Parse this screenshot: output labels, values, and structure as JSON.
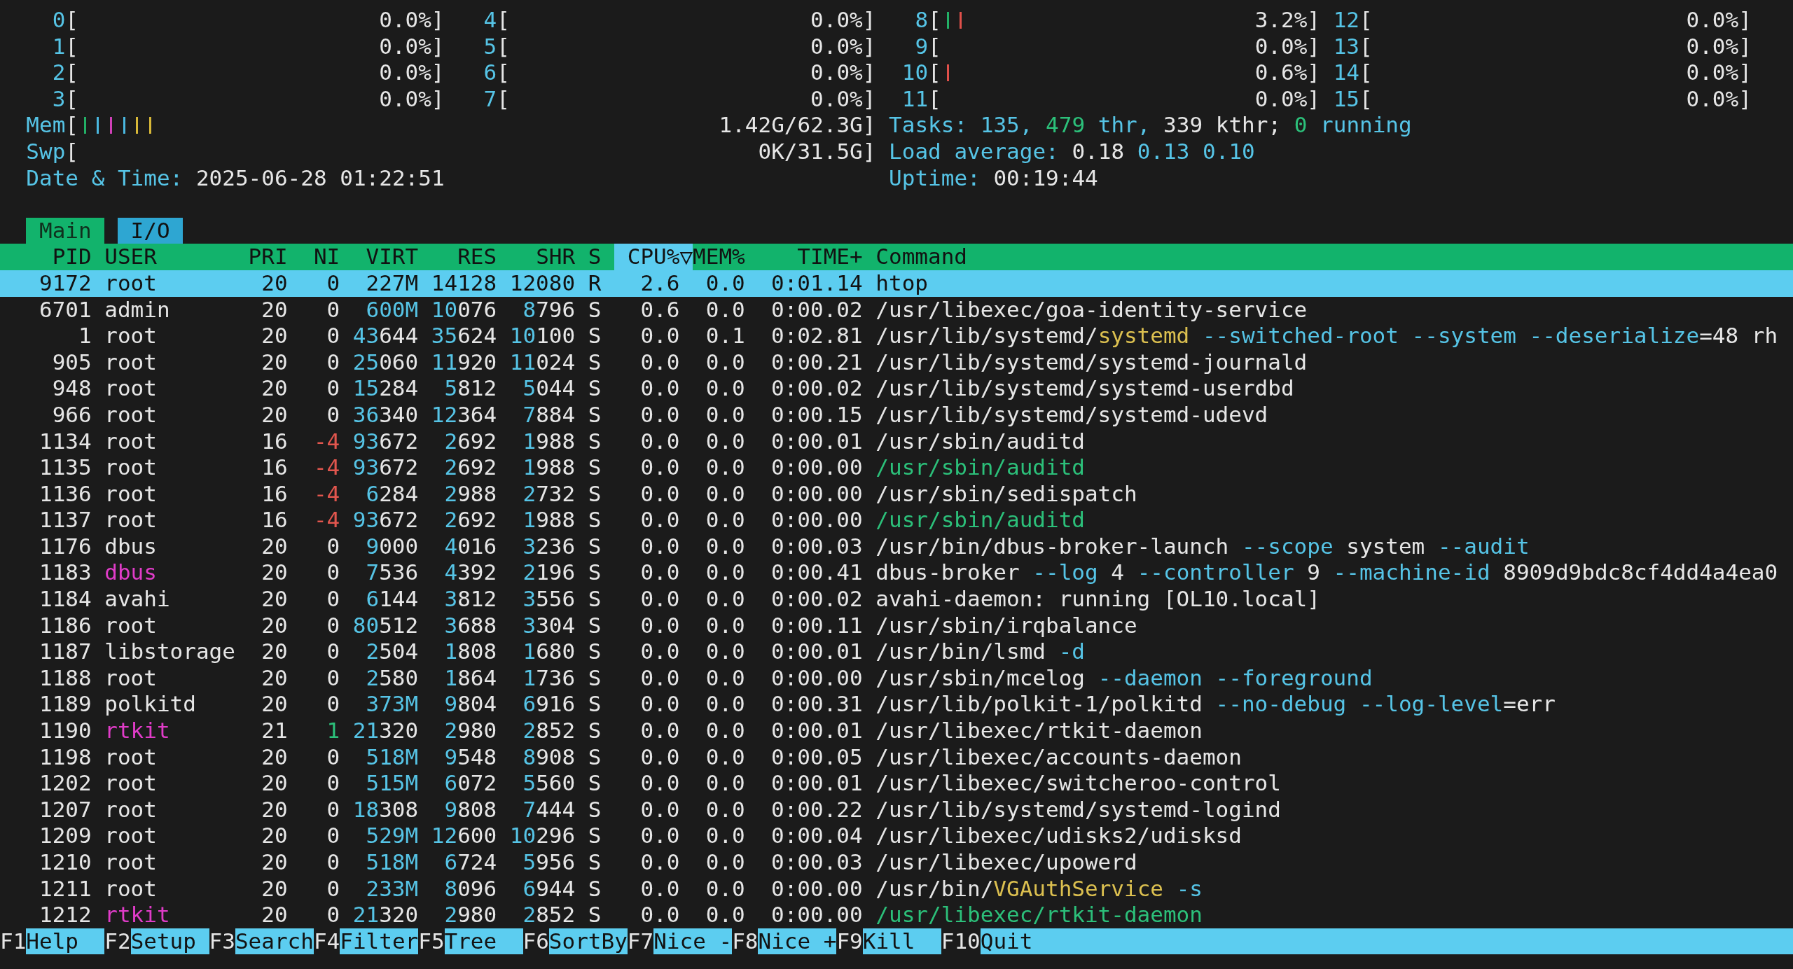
{
  "cpu_meters": [
    {
      "label": "0",
      "open": "[",
      "reading": "0.0%]"
    },
    {
      "label": "1",
      "open": "[",
      "reading": "0.0%]"
    },
    {
      "label": "2",
      "open": "[",
      "reading": "0.0%]"
    },
    {
      "label": "3",
      "open": "[",
      "reading": "0.0%]"
    },
    {
      "label": "4",
      "open": "[",
      "reading": "0.0%]"
    },
    {
      "label": "5",
      "open": "[",
      "reading": "0.0%]"
    },
    {
      "label": "6",
      "open": "[",
      "reading": "0.0%]"
    },
    {
      "label": "7",
      "open": "[",
      "reading": "0.0%]"
    },
    {
      "label": "8",
      "open": "[",
      "reading": "3.2%]",
      "ticks": [
        {
          "color": "#22b066"
        },
        {
          "color": "#e0504a"
        }
      ]
    },
    {
      "label": "9",
      "open": "[",
      "reading": "0.0%]"
    },
    {
      "label": "10",
      "open": "[",
      "reading": "0.6%]",
      "ticks": [
        {
          "color": "#e0504a"
        }
      ]
    },
    {
      "label": "11",
      "open": "[",
      "reading": "0.0%]"
    },
    {
      "label": "12",
      "open": "[",
      "reading": "0.0%]"
    },
    {
      "label": "13",
      "open": "[",
      "reading": "0.0%]"
    },
    {
      "label": "14",
      "open": "[",
      "reading": "0.0%]"
    },
    {
      "label": "15",
      "open": "[",
      "reading": "0.0%]"
    }
  ],
  "memory": {
    "label": "Mem",
    "open": "[",
    "reading": "1.42G/62.3G]",
    "ticks": [
      {
        "color": "#22b066"
      },
      {
        "color": "#4ab8e0"
      },
      {
        "color": "#d040b8"
      },
      {
        "color": "#4ab8e0"
      },
      {
        "color": "#d8b838"
      },
      {
        "color": "#d8b838"
      }
    ]
  },
  "swap": {
    "label": "Swp",
    "open": "[",
    "reading": "0K/31.5G]"
  },
  "tasks": [
    {
      "text": "Tasks: ",
      "kind": "label"
    },
    {
      "text": "135",
      "kind": "label"
    },
    {
      "text": ", ",
      "kind": "label"
    },
    {
      "text": "479",
      "kind": "green"
    },
    {
      "text": " thr, ",
      "kind": "label"
    },
    {
      "text": "339 kthr; ",
      "kind": "value"
    },
    {
      "text": "0",
      "kind": "green"
    },
    {
      "text": " running",
      "kind": "label"
    }
  ],
  "load_average": [
    {
      "text": "Load average: ",
      "kind": "label"
    },
    {
      "text": "0.18 ",
      "kind": "value"
    },
    {
      "text": "0.13 0.10",
      "kind": "label"
    }
  ],
  "date_time": [
    {
      "text": "Date & Time: ",
      "kind": "label"
    },
    {
      "text": "2025-06-28 01:22:51",
      "kind": "value"
    }
  ],
  "uptime": [
    {
      "text": "Uptime: ",
      "kind": "label"
    },
    {
      "text": "00:19:44",
      "kind": "value"
    }
  ],
  "tabs": [
    {
      "label": "Main",
      "selected": true
    },
    {
      "label": "I/O",
      "selected": false
    }
  ],
  "columns": [
    {
      "label": "PID",
      "selected": false
    },
    {
      "label": "USER",
      "selected": false
    },
    {
      "label": "PRI",
      "selected": false
    },
    {
      "label": "NI",
      "selected": false
    },
    {
      "label": "VIRT",
      "selected": false
    },
    {
      "label": "RES",
      "selected": false
    },
    {
      "label": "SHR",
      "selected": false
    },
    {
      "label": "S",
      "selected": false
    },
    {
      "label": "CPU%▽",
      "selected": true
    },
    {
      "label": "MEM%",
      "selected": false
    },
    {
      "label": "TIME+",
      "selected": false
    },
    {
      "label": "Command",
      "selected": false
    }
  ],
  "processes": [
    {
      "pid": "9172",
      "user": "root",
      "highlighted_user": false,
      "pri": "20",
      "ni": "0",
      "nice_negative": false,
      "nice_positive": false,
      "virt": "227M",
      "res": "14128",
      "shr": "12080",
      "state": "R",
      "cpu": "2.6",
      "mem": "0.0",
      "time": "0:01.14",
      "command": [
        {
          "text": "htop",
          "kind": "path"
        }
      ],
      "selected": true
    },
    {
      "pid": "6701",
      "user": "admin",
      "highlighted_user": false,
      "pri": "20",
      "ni": "0",
      "nice_negative": false,
      "nice_positive": false,
      "virt": "600M",
      "res": "10076",
      "shr": "8796",
      "state": "S",
      "cpu": "0.6",
      "mem": "0.0",
      "time": "0:00.02",
      "command": [
        {
          "text": "/usr/libexec/goa-identity-service",
          "kind": "path"
        }
      ],
      "selected": false
    },
    {
      "pid": "1",
      "user": "root",
      "highlighted_user": false,
      "pri": "20",
      "ni": "0",
      "nice_negative": false,
      "nice_positive": false,
      "virt": "43644",
      "res": "35624",
      "shr": "10100",
      "state": "S",
      "cpu": "0.0",
      "mem": "0.1",
      "time": "0:02.81",
      "command": [
        {
          "text": "/usr/lib/systemd/",
          "kind": "path"
        },
        {
          "text": "systemd",
          "kind": "basename"
        },
        {
          "text": " --switched-root --system --deserialize",
          "kind": "arg"
        },
        {
          "text": "=48 rh",
          "kind": "path"
        }
      ],
      "selected": false
    },
    {
      "pid": "905",
      "user": "root",
      "highlighted_user": false,
      "pri": "20",
      "ni": "0",
      "nice_negative": false,
      "nice_positive": false,
      "virt": "25060",
      "res": "11920",
      "shr": "11024",
      "state": "S",
      "cpu": "0.0",
      "mem": "0.0",
      "time": "0:00.21",
      "command": [
        {
          "text": "/usr/lib/systemd/systemd-journald",
          "kind": "path"
        }
      ],
      "selected": false
    },
    {
      "pid": "948",
      "user": "root",
      "highlighted_user": false,
      "pri": "20",
      "ni": "0",
      "nice_negative": false,
      "nice_positive": false,
      "virt": "15284",
      "res": "5812",
      "shr": "5044",
      "state": "S",
      "cpu": "0.0",
      "mem": "0.0",
      "time": "0:00.02",
      "command": [
        {
          "text": "/usr/lib/systemd/systemd-userdbd",
          "kind": "path"
        }
      ],
      "selected": false
    },
    {
      "pid": "966",
      "user": "root",
      "highlighted_user": false,
      "pri": "20",
      "ni": "0",
      "nice_negative": false,
      "nice_positive": false,
      "virt": "36340",
      "res": "12364",
      "shr": "7884",
      "state": "S",
      "cpu": "0.0",
      "mem": "0.0",
      "time": "0:00.15",
      "command": [
        {
          "text": "/usr/lib/systemd/systemd-udevd",
          "kind": "path"
        }
      ],
      "selected": false
    },
    {
      "pid": "1134",
      "user": "root",
      "highlighted_user": false,
      "pri": "16",
      "ni": "-4",
      "nice_negative": true,
      "nice_positive": false,
      "virt": "93672",
      "res": "2692",
      "shr": "1988",
      "state": "S",
      "cpu": "0.0",
      "mem": "0.0",
      "time": "0:00.01",
      "command": [
        {
          "text": "/usr/sbin/auditd",
          "kind": "path"
        }
      ],
      "selected": false
    },
    {
      "pid": "1135",
      "user": "root",
      "highlighted_user": false,
      "pri": "16",
      "ni": "-4",
      "nice_negative": true,
      "nice_positive": false,
      "virt": "93672",
      "res": "2692",
      "shr": "1988",
      "state": "S",
      "cpu": "0.0",
      "mem": "0.0",
      "time": "0:00.00",
      "command": [
        {
          "text": "/usr/sbin/auditd",
          "kind": "thread"
        }
      ],
      "selected": false
    },
    {
      "pid": "1136",
      "user": "root",
      "highlighted_user": false,
      "pri": "16",
      "ni": "-4",
      "nice_negative": true,
      "nice_positive": false,
      "virt": "6284",
      "res": "2988",
      "shr": "2732",
      "state": "S",
      "cpu": "0.0",
      "mem": "0.0",
      "time": "0:00.00",
      "command": [
        {
          "text": "/usr/sbin/sedispatch",
          "kind": "path"
        }
      ],
      "selected": false
    },
    {
      "pid": "1137",
      "user": "root",
      "highlighted_user": false,
      "pri": "16",
      "ni": "-4",
      "nice_negative": true,
      "nice_positive": false,
      "virt": "93672",
      "res": "2692",
      "shr": "1988",
      "state": "S",
      "cpu": "0.0",
      "mem": "0.0",
      "time": "0:00.00",
      "command": [
        {
          "text": "/usr/sbin/auditd",
          "kind": "thread"
        }
      ],
      "selected": false
    },
    {
      "pid": "1176",
      "user": "dbus",
      "highlighted_user": false,
      "pri": "20",
      "ni": "0",
      "nice_negative": false,
      "nice_positive": false,
      "virt": "9000",
      "res": "4016",
      "shr": "3236",
      "state": "S",
      "cpu": "0.0",
      "mem": "0.0",
      "time": "0:00.03",
      "command": [
        {
          "text": "/usr/bin/dbus-broker-launch ",
          "kind": "path"
        },
        {
          "text": "--scope",
          "kind": "arg"
        },
        {
          "text": " system ",
          "kind": "path"
        },
        {
          "text": "--audit",
          "kind": "arg"
        }
      ],
      "selected": false
    },
    {
      "pid": "1183",
      "user": "dbus",
      "highlighted_user": true,
      "pri": "20",
      "ni": "0",
      "nice_negative": false,
      "nice_positive": false,
      "virt": "7536",
      "res": "4392",
      "shr": "2196",
      "state": "S",
      "cpu": "0.0",
      "mem": "0.0",
      "time": "0:00.41",
      "command": [
        {
          "text": "dbus-broker ",
          "kind": "path"
        },
        {
          "text": "--log",
          "kind": "arg"
        },
        {
          "text": " 4 ",
          "kind": "path"
        },
        {
          "text": "--controller",
          "kind": "arg"
        },
        {
          "text": " 9 ",
          "kind": "path"
        },
        {
          "text": "--machine-id",
          "kind": "arg"
        },
        {
          "text": " 8909d9bdc8cf4dd4a4ea0",
          "kind": "path"
        }
      ],
      "selected": false
    },
    {
      "pid": "1184",
      "user": "avahi",
      "highlighted_user": false,
      "pri": "20",
      "ni": "0",
      "nice_negative": false,
      "nice_positive": false,
      "virt": "6144",
      "res": "3812",
      "shr": "3556",
      "state": "S",
      "cpu": "0.0",
      "mem": "0.0",
      "time": "0:00.02",
      "command": [
        {
          "text": "avahi-daemon: running [OL10.local]",
          "kind": "path"
        }
      ],
      "selected": false
    },
    {
      "pid": "1186",
      "user": "root",
      "highlighted_user": false,
      "pri": "20",
      "ni": "0",
      "nice_negative": false,
      "nice_positive": false,
      "virt": "80512",
      "res": "3688",
      "shr": "3304",
      "state": "S",
      "cpu": "0.0",
      "mem": "0.0",
      "time": "0:00.11",
      "command": [
        {
          "text": "/usr/sbin/irqbalance",
          "kind": "path"
        }
      ],
      "selected": false
    },
    {
      "pid": "1187",
      "user": "libstorage",
      "highlighted_user": false,
      "pri": "20",
      "ni": "0",
      "nice_negative": false,
      "nice_positive": false,
      "virt": "2504",
      "res": "1808",
      "shr": "1680",
      "state": "S",
      "cpu": "0.0",
      "mem": "0.0",
      "time": "0:00.01",
      "command": [
        {
          "text": "/usr/bin/lsmd ",
          "kind": "path"
        },
        {
          "text": "-d",
          "kind": "arg"
        }
      ],
      "selected": false
    },
    {
      "pid": "1188",
      "user": "root",
      "highlighted_user": false,
      "pri": "20",
      "ni": "0",
      "nice_negative": false,
      "nice_positive": false,
      "virt": "2580",
      "res": "1864",
      "shr": "1736",
      "state": "S",
      "cpu": "0.0",
      "mem": "0.0",
      "time": "0:00.00",
      "command": [
        {
          "text": "/usr/sbin/mcelog ",
          "kind": "path"
        },
        {
          "text": "--daemon --foreground",
          "kind": "arg"
        }
      ],
      "selected": false
    },
    {
      "pid": "1189",
      "user": "polkitd",
      "highlighted_user": false,
      "pri": "20",
      "ni": "0",
      "nice_negative": false,
      "nice_positive": false,
      "virt": "373M",
      "res": "9804",
      "shr": "6916",
      "state": "S",
      "cpu": "0.0",
      "mem": "0.0",
      "time": "0:00.31",
      "command": [
        {
          "text": "/usr/lib/polkit-1/polkitd ",
          "kind": "path"
        },
        {
          "text": "--no-debug --log-level",
          "kind": "arg"
        },
        {
          "text": "=err",
          "kind": "path"
        }
      ],
      "selected": false
    },
    {
      "pid": "1190",
      "user": "rtkit",
      "highlighted_user": true,
      "pri": "21",
      "ni": "1",
      "nice_negative": false,
      "nice_positive": true,
      "virt": "21320",
      "res": "2980",
      "shr": "2852",
      "state": "S",
      "cpu": "0.0",
      "mem": "0.0",
      "time": "0:00.01",
      "command": [
        {
          "text": "/usr/libexec/rtkit-daemon",
          "kind": "path"
        }
      ],
      "selected": false
    },
    {
      "pid": "1198",
      "user": "root",
      "highlighted_user": false,
      "pri": "20",
      "ni": "0",
      "nice_negative": false,
      "nice_positive": false,
      "virt": "518M",
      "res": "9548",
      "shr": "8908",
      "state": "S",
      "cpu": "0.0",
      "mem": "0.0",
      "time": "0:00.05",
      "command": [
        {
          "text": "/usr/libexec/accounts-daemon",
          "kind": "path"
        }
      ],
      "selected": false
    },
    {
      "pid": "1202",
      "user": "root",
      "highlighted_user": false,
      "pri": "20",
      "ni": "0",
      "nice_negative": false,
      "nice_positive": false,
      "virt": "515M",
      "res": "6072",
      "shr": "5560",
      "state": "S",
      "cpu": "0.0",
      "mem": "0.0",
      "time": "0:00.01",
      "command": [
        {
          "text": "/usr/libexec/switcheroo-control",
          "kind": "path"
        }
      ],
      "selected": false
    },
    {
      "pid": "1207",
      "user": "root",
      "highlighted_user": false,
      "pri": "20",
      "ni": "0",
      "nice_negative": false,
      "nice_positive": false,
      "virt": "18308",
      "res": "9808",
      "shr": "7444",
      "state": "S",
      "cpu": "0.0",
      "mem": "0.0",
      "time": "0:00.22",
      "command": [
        {
          "text": "/usr/lib/systemd/systemd-logind",
          "kind": "path"
        }
      ],
      "selected": false
    },
    {
      "pid": "1209",
      "user": "root",
      "highlighted_user": false,
      "pri": "20",
      "ni": "0",
      "nice_negative": false,
      "nice_positive": false,
      "virt": "529M",
      "res": "12600",
      "shr": "10296",
      "state": "S",
      "cpu": "0.0",
      "mem": "0.0",
      "time": "0:00.04",
      "command": [
        {
          "text": "/usr/libexec/udisks2/udisksd",
          "kind": "path"
        }
      ],
      "selected": false
    },
    {
      "pid": "1210",
      "user": "root",
      "highlighted_user": false,
      "pri": "20",
      "ni": "0",
      "nice_negative": false,
      "nice_positive": false,
      "virt": "518M",
      "res": "6724",
      "shr": "5956",
      "state": "S",
      "cpu": "0.0",
      "mem": "0.0",
      "time": "0:00.03",
      "command": [
        {
          "text": "/usr/libexec/upowerd",
          "kind": "path"
        }
      ],
      "selected": false
    },
    {
      "pid": "1211",
      "user": "root",
      "highlighted_user": false,
      "pri": "20",
      "ni": "0",
      "nice_negative": false,
      "nice_positive": false,
      "virt": "233M",
      "res": "8096",
      "shr": "6944",
      "state": "S",
      "cpu": "0.0",
      "mem": "0.0",
      "time": "0:00.00",
      "command": [
        {
          "text": "/usr/bin/",
          "kind": "path"
        },
        {
          "text": "VGAuthService",
          "kind": "basename"
        },
        {
          "text": " -s",
          "kind": "arg"
        }
      ],
      "selected": false
    },
    {
      "pid": "1212",
      "user": "rtkit",
      "highlighted_user": true,
      "pri": "20",
      "ni": "0",
      "nice_negative": false,
      "nice_positive": false,
      "virt": "21320",
      "res": "2980",
      "shr": "2852",
      "state": "S",
      "cpu": "0.0",
      "mem": "0.0",
      "time": "0:00.00",
      "command": [
        {
          "text": "/usr/libexec/rtkit-daemon",
          "kind": "thread"
        }
      ],
      "selected": false
    }
  ],
  "function_keys": [
    {
      "key": "F1",
      "label": "Help"
    },
    {
      "key": "F2",
      "label": "Setup"
    },
    {
      "key": "F3",
      "label": "Search"
    },
    {
      "key": "F4",
      "label": "Filter"
    },
    {
      "key": "F5",
      "label": "Tree"
    },
    {
      "key": "F6",
      "label": "SortBy"
    },
    {
      "key": "F7",
      "label": "Nice -"
    },
    {
      "key": "F8",
      "label": "Nice +"
    },
    {
      "key": "F9",
      "label": "Kill"
    },
    {
      "key": "F10",
      "label": "Quit"
    }
  ]
}
